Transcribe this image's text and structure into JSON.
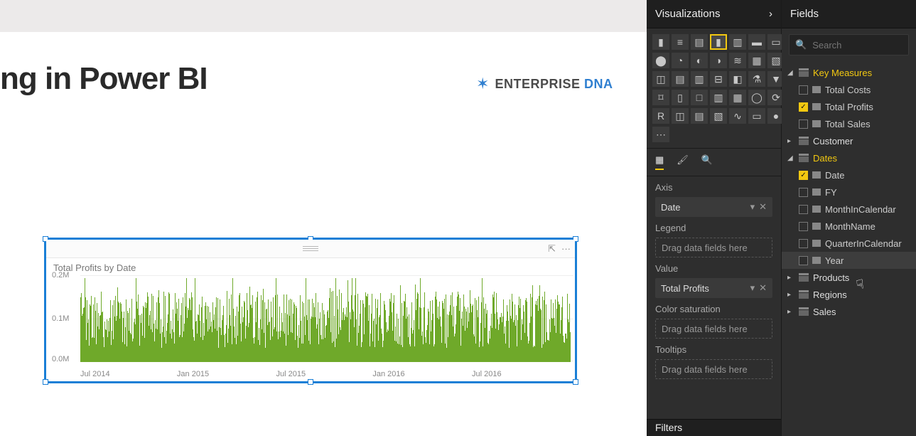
{
  "page": {
    "title": "ng in Power BI",
    "logo_main": "ENTERPRISE",
    "logo_accent": "DNA"
  },
  "visual": {
    "title": "Total Profits by Date",
    "pop_icon": "⇱",
    "more_icon": "···"
  },
  "chart_data": {
    "type": "bar",
    "title": "Total Profits by Date",
    "xlabel": "",
    "ylabel": "",
    "ylim": [
      0,
      200000
    ],
    "y_ticks": [
      "0.0M",
      "0.1M",
      "0.2M"
    ],
    "x_categories": [
      "Jul 2014",
      "Jan 2015",
      "Jul 2015",
      "Jan 2016",
      "Jul 2016"
    ],
    "series": [
      {
        "name": "Total Profits",
        "values_approx_note": "daily values ~700 days Jul 2014–Dec 2016, range 0–0.18M, typical 0.05–0.12M"
      }
    ]
  },
  "viz_panel": {
    "header": "Visualizations",
    "collapse": "›",
    "wells": {
      "axis_label": "Axis",
      "axis_value": "Date",
      "legend_label": "Legend",
      "legend_placeholder": "Drag data fields here",
      "value_label": "Value",
      "value_value": "Total Profits",
      "sat_label": "Color saturation",
      "sat_placeholder": "Drag data fields here",
      "tooltip_label": "Tooltips",
      "tooltip_placeholder": "Drag data fields here"
    },
    "filters_header": "Filters"
  },
  "fields_panel": {
    "header": "Fields",
    "search_placeholder": "Search",
    "tables": [
      {
        "name": "Key Measures",
        "expanded": true,
        "active": true,
        "fields": [
          {
            "name": "Total Costs",
            "checked": false
          },
          {
            "name": "Total Profits",
            "checked": true
          },
          {
            "name": "Total Sales",
            "checked": false
          }
        ]
      },
      {
        "name": "Customer",
        "expanded": false
      },
      {
        "name": "Dates",
        "expanded": true,
        "active": true,
        "fields": [
          {
            "name": "Date",
            "checked": true
          },
          {
            "name": "FY",
            "checked": false
          },
          {
            "name": "MonthInCalendar",
            "checked": false
          },
          {
            "name": "MonthName",
            "checked": false
          },
          {
            "name": "QuarterInCalendar",
            "checked": false
          },
          {
            "name": "Year",
            "checked": false,
            "hover": true
          }
        ]
      },
      {
        "name": "Products",
        "expanded": false
      },
      {
        "name": "Regions",
        "expanded": false
      },
      {
        "name": "Sales",
        "expanded": false
      }
    ]
  }
}
